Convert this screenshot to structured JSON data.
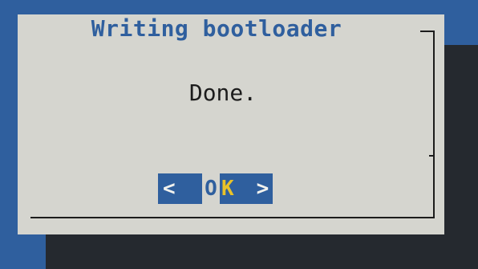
{
  "dialog": {
    "title": "Writing bootloader",
    "message": "Done."
  },
  "ok_button": {
    "left_bracket": "<",
    "label_start": "O",
    "hotkey": "K",
    "right_bracket": ">"
  },
  "colors": {
    "background": "#2f5f9e",
    "dialog": "#d5d5cf",
    "shadow": "#25292f",
    "title": "#2f5f9e",
    "hotkey": "#e8c229"
  }
}
